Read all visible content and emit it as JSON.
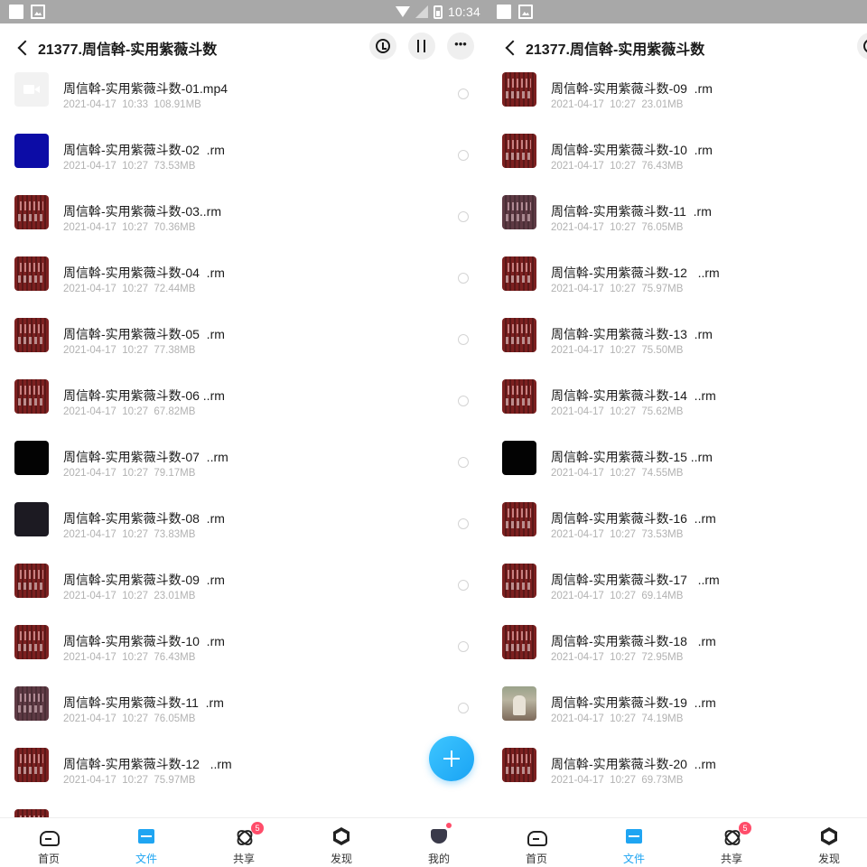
{
  "status_bar": {
    "time": "10:34"
  },
  "left": {
    "title": "21377.周信斡-实用紫薇斗数",
    "files": [
      {
        "name": "周信斡-实用紫薇斗数-01.mp4",
        "date": "2021-04-17  10:33",
        "size": "108.91MB",
        "thumb": "video"
      },
      {
        "name": "周信斡-实用紫薇斗数-02  .rm",
        "date": "2021-04-17  10:27",
        "size": "73.53MB",
        "thumb": "blue"
      },
      {
        "name": "周信斡-实用紫薇斗数-03..rm",
        "date": "2021-04-17  10:27",
        "size": "70.36MB",
        "thumb": "red"
      },
      {
        "name": "周信斡-实用紫薇斗数-04  .rm",
        "date": "2021-04-17  10:27",
        "size": "72.44MB",
        "thumb": "red"
      },
      {
        "name": "周信斡-实用紫薇斗数-05  .rm",
        "date": "2021-04-17  10:27",
        "size": "77.38MB",
        "thumb": "red"
      },
      {
        "name": "周信斡-实用紫薇斗数-06 ..rm",
        "date": "2021-04-17  10:27",
        "size": "67.82MB",
        "thumb": "red"
      },
      {
        "name": "周信斡-实用紫薇斗数-07  ..rm",
        "date": "2021-04-17  10:27",
        "size": "79.17MB",
        "thumb": "black"
      },
      {
        "name": "周信斡-实用紫薇斗数-08  .rm",
        "date": "2021-04-17  10:27",
        "size": "73.83MB",
        "thumb": "dark"
      },
      {
        "name": "周信斡-实用紫薇斗数-09  .rm",
        "date": "2021-04-17  10:27",
        "size": "23.01MB",
        "thumb": "red"
      },
      {
        "name": "周信斡-实用紫薇斗数-10  .rm",
        "date": "2021-04-17  10:27",
        "size": "76.43MB",
        "thumb": "red"
      },
      {
        "name": "周信斡-实用紫薇斗数-11  .rm",
        "date": "2021-04-17  10:27",
        "size": "76.05MB",
        "thumb": "mauve"
      },
      {
        "name": "周信斡-实用紫薇斗数-12   ..rm",
        "date": "2021-04-17  10:27",
        "size": "75.97MB",
        "thumb": "red"
      },
      {
        "name": "周信斡-实用紫薇斗数-13  .rm",
        "date": "2021-04-17  10:27",
        "size": "75.50MB",
        "thumb": "red"
      }
    ]
  },
  "right": {
    "title": "21377.周信斡-实用紫薇斗数",
    "files": [
      {
        "name": "周信斡-实用紫薇斗数-09  .rm",
        "date": "2021-04-17  10:27",
        "size": "23.01MB",
        "thumb": "red"
      },
      {
        "name": "周信斡-实用紫薇斗数-10  .rm",
        "date": "2021-04-17  10:27",
        "size": "76.43MB",
        "thumb": "red"
      },
      {
        "name": "周信斡-实用紫薇斗数-11  .rm",
        "date": "2021-04-17  10:27",
        "size": "76.05MB",
        "thumb": "mauve"
      },
      {
        "name": "周信斡-实用紫薇斗数-12   ..rm",
        "date": "2021-04-17  10:27",
        "size": "75.97MB",
        "thumb": "red"
      },
      {
        "name": "周信斡-实用紫薇斗数-13  .rm",
        "date": "2021-04-17  10:27",
        "size": "75.50MB",
        "thumb": "red"
      },
      {
        "name": "周信斡-实用紫薇斗数-14  ..rm",
        "date": "2021-04-17  10:27",
        "size": "75.62MB",
        "thumb": "red"
      },
      {
        "name": "周信斡-实用紫薇斗数-15 ..rm",
        "date": "2021-04-17  10:27",
        "size": "74.55MB",
        "thumb": "black"
      },
      {
        "name": "周信斡-实用紫薇斗数-16  ..rm",
        "date": "2021-04-17  10:27",
        "size": "73.53MB",
        "thumb": "red"
      },
      {
        "name": "周信斡-实用紫薇斗数-17   ..rm",
        "date": "2021-04-17  10:27",
        "size": "69.14MB",
        "thumb": "red"
      },
      {
        "name": "周信斡-实用紫薇斗数-18   .rm",
        "date": "2021-04-17  10:27",
        "size": "72.95MB",
        "thumb": "red"
      },
      {
        "name": "周信斡-实用紫薇斗数-19  ..rm",
        "date": "2021-04-17  10:27",
        "size": "74.19MB",
        "thumb": "photo"
      },
      {
        "name": "周信斡-实用紫薇斗数-20  ..rm",
        "date": "2021-04-17  10:27",
        "size": "69.73MB",
        "thumb": "red"
      }
    ]
  },
  "tabs": [
    {
      "label": "首页",
      "icon": "home-icon"
    },
    {
      "label": "文件",
      "icon": "folder-icon",
      "active": true
    },
    {
      "label": "共享",
      "icon": "share-icon",
      "badge": "5"
    },
    {
      "label": "发现",
      "icon": "discover-icon"
    },
    {
      "label": "我的",
      "icon": "mine-icon",
      "dot": true
    }
  ],
  "colors": {
    "accent": "#1fa5f2",
    "badge": "#ff4d6a",
    "status_bar": "#a8a8a8",
    "meta_text": "#b2b2b2"
  }
}
